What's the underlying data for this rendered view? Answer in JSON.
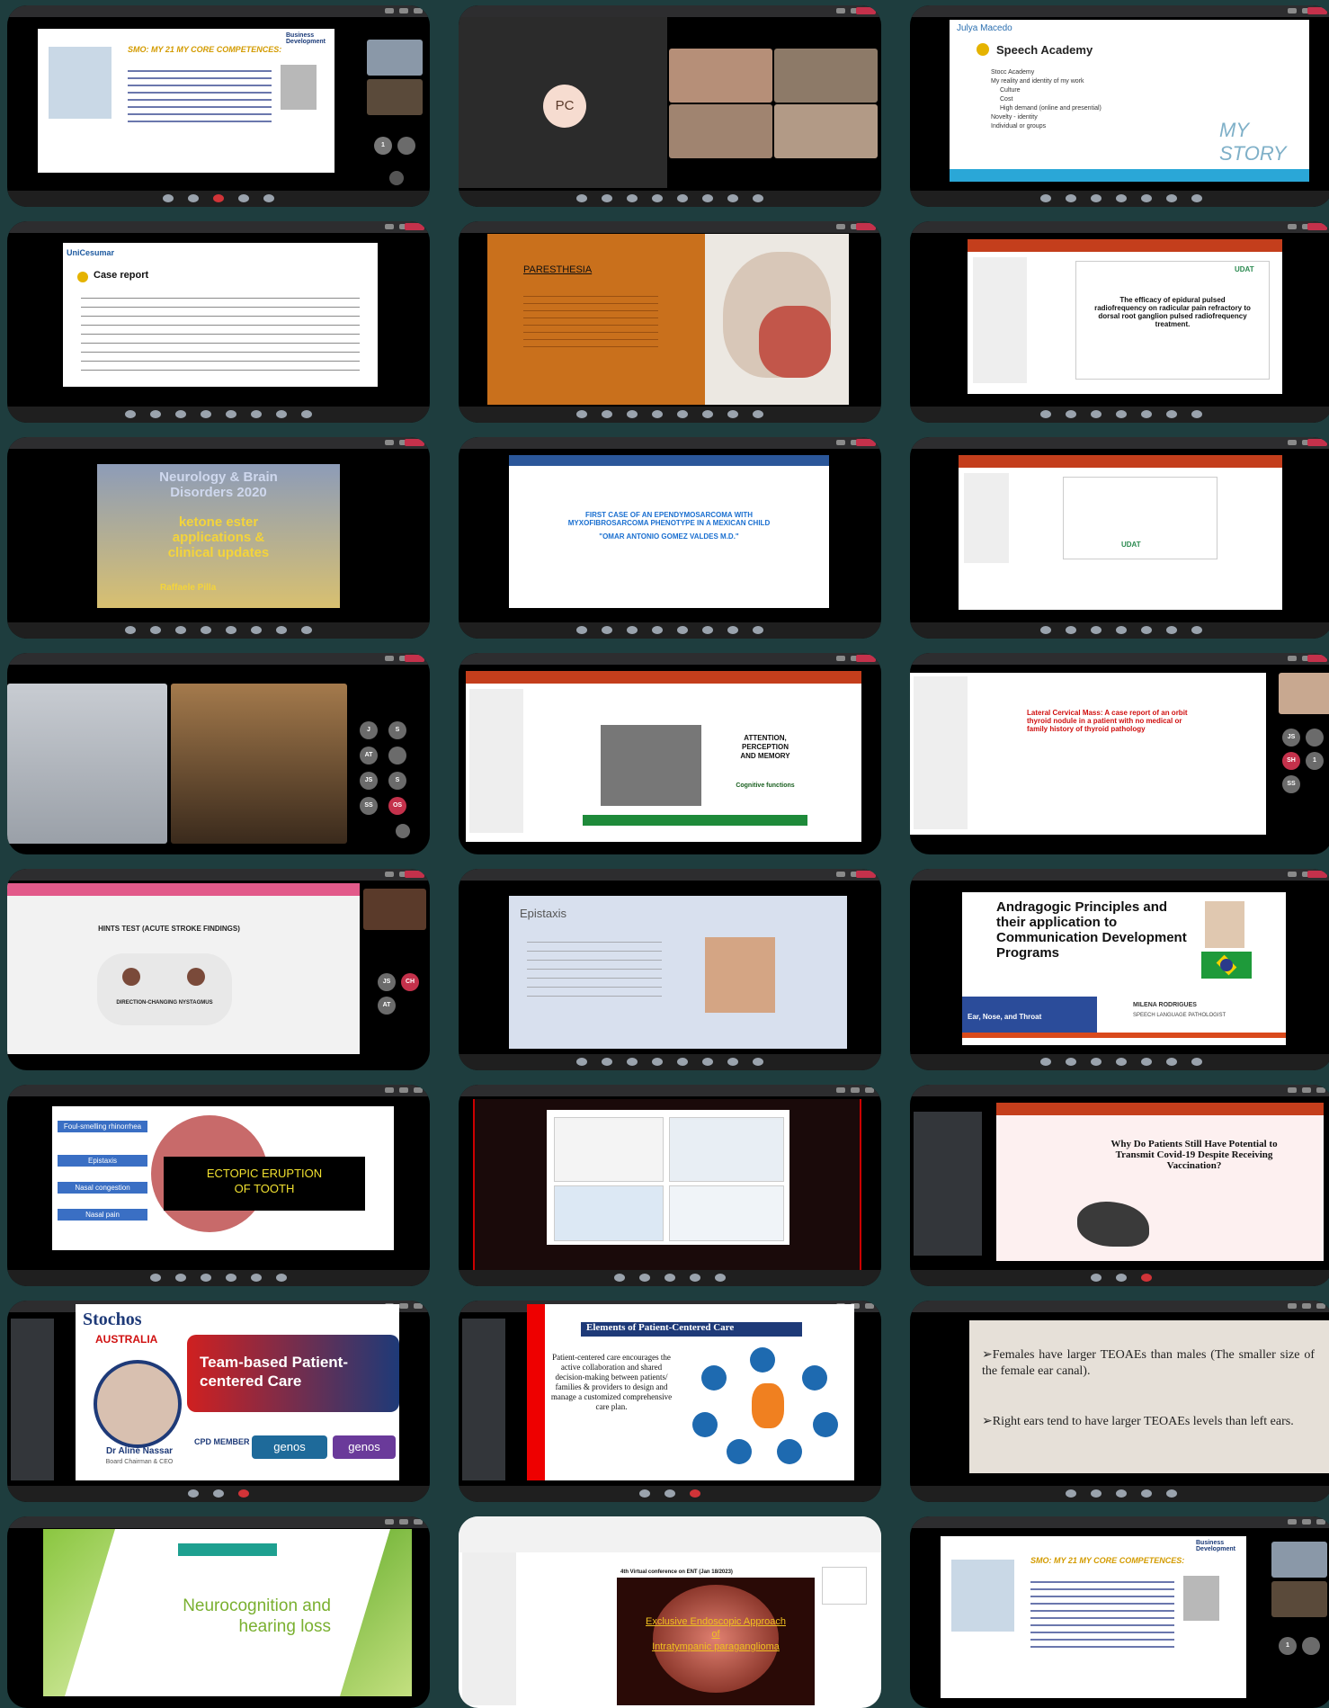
{
  "tiles": {
    "t1": {
      "title": "SMO: MY 21 MY CORE COMPETENCES:",
      "sub": "Business Development"
    },
    "t2": {
      "pc_label": "PC"
    },
    "t3": {
      "presenter": "Julya Macedo",
      "heading": "Speech Academy",
      "bullets": [
        "Stocc Academy",
        "My reality and identity of my work",
        "Culture",
        "Cost",
        "High demand (online and presential)",
        "Novelty - identity",
        "Individual or groups"
      ],
      "logo": "MY STORY"
    },
    "t4": {
      "brand": "UniCesumar",
      "heading": "Case report"
    },
    "t5": {
      "heading": "PARESTHESIA"
    },
    "t6": {
      "logo": "UDAT",
      "title": "The efficacy of epidural pulsed radiofrequency on radicular pain refractory to dorsal root ganglion pulsed radiofrequency treatment."
    },
    "t7": {
      "line1": "Neurology & Brain",
      "line2": "Disorders 2020",
      "line3": "ketone ester",
      "line4": "applications &",
      "line5": "clinical updates",
      "speaker": "Raffaele Pilla"
    },
    "t8": {
      "title": "FIRST CASE OF AN EPENDYMOSARCOMA WITH MYXOFIBROSARCOMA PHENOTYPE IN A MEXICAN CHILD",
      "author": "\"OMAR ANTONIO GOMEZ VALDES M.D.\""
    },
    "t9": {
      "logo": "UDAT"
    },
    "t10": {},
    "t11": {
      "line1": "ATTENTION,",
      "line2": "PERCEPTION",
      "line3": "AND MEMORY",
      "line4": "Cognitive functions"
    },
    "t12": {
      "title": "Lateral Cervical Mass: A case report of an orbit thyroid nodule in a patient with no medical or family history of thyroid pathology"
    },
    "t13": {
      "title": "HINTS TEST (ACUTE STROKE FINDINGS)",
      "caption": "DIRECTION-CHANGING NYSTAGMUS"
    },
    "t14": {
      "heading": "Epistaxis"
    },
    "t15": {
      "title": "Andragogic Principles and their application to Communication Development Programs",
      "event": "Ear, Nose, and Throat",
      "speaker": "MILENA RODRIGUES",
      "role": "SPEECH LANGUAGE PATHOLOGIST"
    },
    "t16": {
      "labels": [
        "Foul-smelling rhinorrhea",
        "Epistaxis",
        "Nasal congestion",
        "Nasal pain"
      ],
      "title1": "ECTOPIC ERUPTION",
      "title2": "OF TOOTH"
    },
    "t17": {},
    "t18": {
      "title": "Why Do Patients Still Have Potential to Transmit Covid-19 Despite Receiving Vaccination?"
    },
    "t19": {
      "brand": "Stochos",
      "country": "AUSTRALIA",
      "title": "Team-based Patient-centered Care",
      "speaker": "Dr Aline Nassar",
      "role": "Board Chairman & CEO",
      "badge": "CPD MEMBER",
      "partner": "genos"
    },
    "t20": {
      "title": "Elements of Patient-Centered Care",
      "body": "Patient-centered care encourages the active collaboration and shared decision-making between patients/ families & providers to design and manage a customized comprehensive care plan."
    },
    "t21": {
      "line1": "➢Females have larger TEOAEs than males (The smaller size of the female ear canal).",
      "line2": "➢Right ears tend to have larger TEOAEs levels than left ears."
    },
    "t22": {
      "title1": "Neurocognition and",
      "title2": "hearing loss"
    },
    "t23": {
      "conf": "4th Virtual conference on ENT (Jan 18/2023)",
      "title1": "Exclusive Endoscopic Approach",
      "title2": "of",
      "title3": "Intratympanic paraganglioma"
    },
    "t24": {
      "title": "SMO: MY 21 MY CORE COMPETENCES:",
      "sub": "Business Development"
    }
  }
}
